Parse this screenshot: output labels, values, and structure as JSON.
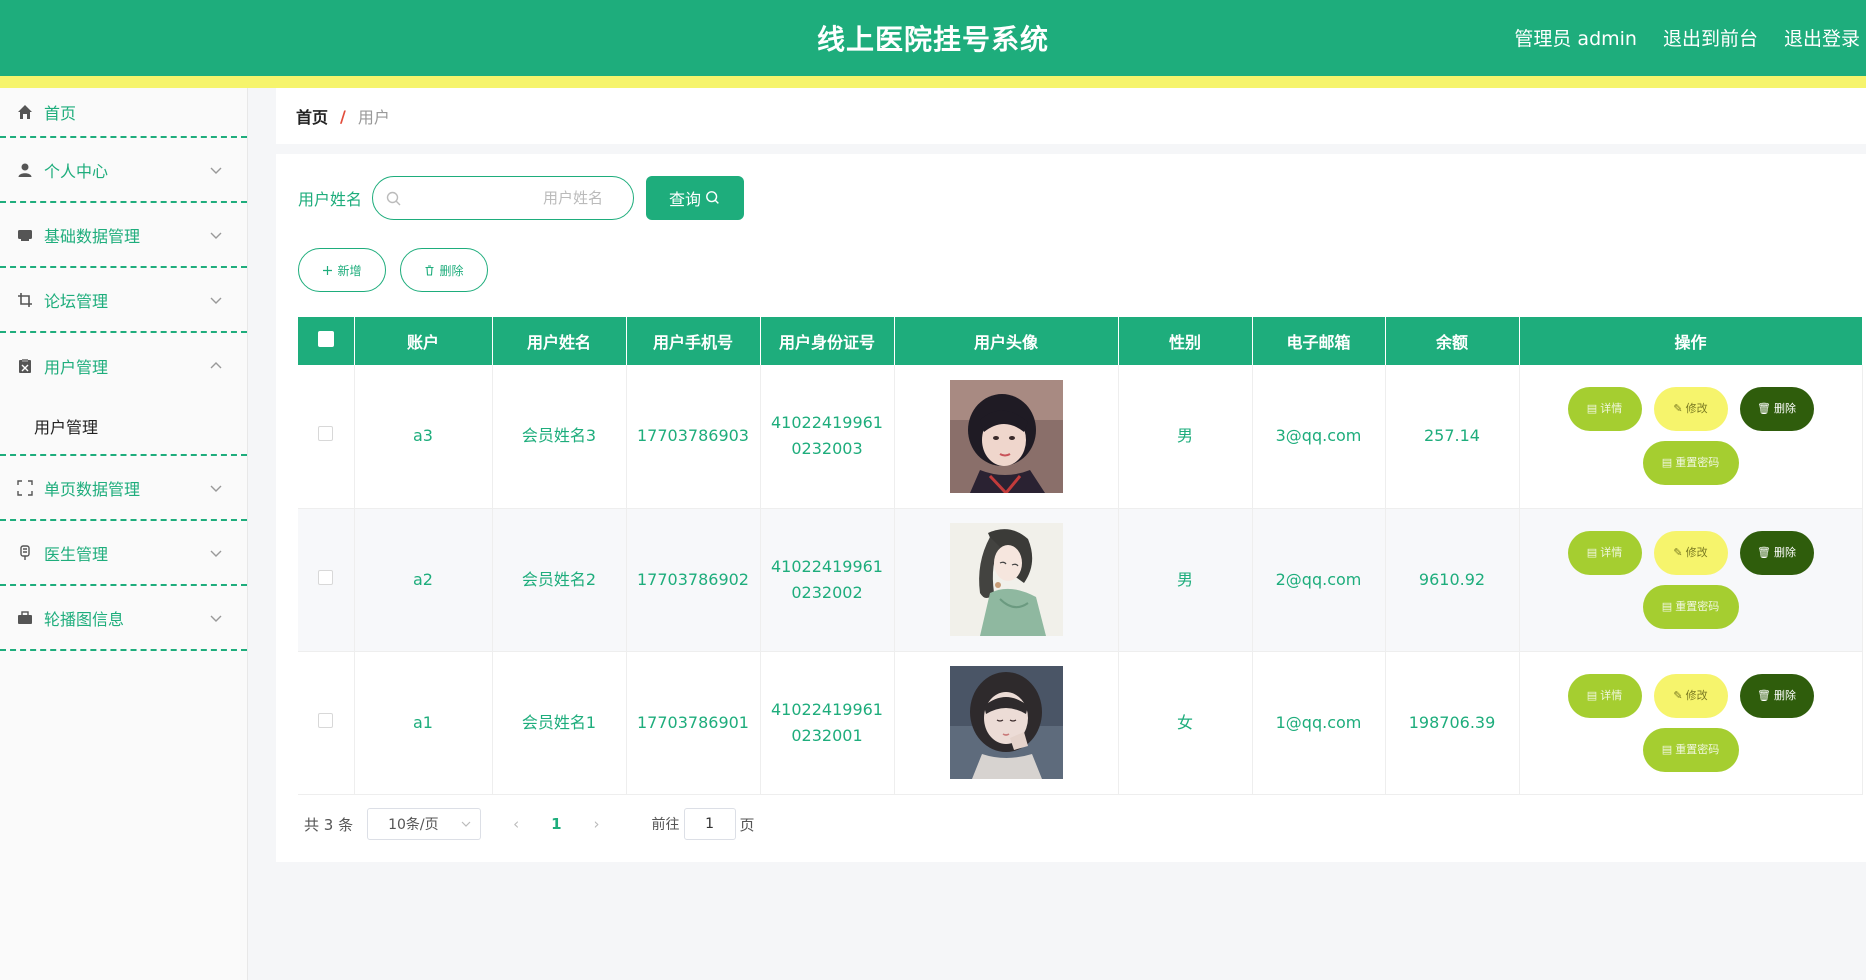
{
  "header": {
    "title": "线上医院挂号系统",
    "admin_label": "管理员 admin",
    "front_link": "退出到前台",
    "logout_link": "退出登录"
  },
  "sidebar": {
    "items": [
      {
        "label": "首页",
        "icon": "home-icon"
      },
      {
        "label": "个人中心",
        "icon": "user-icon"
      },
      {
        "label": "基础数据管理",
        "icon": "data-icon"
      },
      {
        "label": "论坛管理",
        "icon": "crop-icon"
      },
      {
        "label": "用户管理",
        "icon": "clipboard-icon",
        "sub": "用户管理"
      },
      {
        "label": "单页数据管理",
        "icon": "fullscreen-icon"
      },
      {
        "label": "医生管理",
        "icon": "doctor-icon"
      },
      {
        "label": "轮播图信息",
        "icon": "briefcase-icon"
      }
    ]
  },
  "breadcrumb": {
    "home": "首页",
    "separator": "/",
    "current": "用户"
  },
  "search": {
    "label": "用户姓名",
    "placeholder": "用户姓名",
    "value": "",
    "button": "查询"
  },
  "actions": {
    "add": "新增",
    "delete": "删除"
  },
  "table": {
    "headers": [
      "账户",
      "用户姓名",
      "用户手机号",
      "用户身份证号",
      "用户头像",
      "性别",
      "电子邮箱",
      "余额",
      "操作"
    ],
    "rows": [
      {
        "account": "a3",
        "name": "会员姓名3",
        "phone": "17703786903",
        "id_line1": "41022419961",
        "id_line2": "0232003",
        "gender": "男",
        "email": "3@qq.com",
        "balance": "257.14"
      },
      {
        "account": "a2",
        "name": "会员姓名2",
        "phone": "17703786902",
        "id_line1": "41022419961",
        "id_line2": "0232002",
        "gender": "男",
        "email": "2@qq.com",
        "balance": "9610.92"
      },
      {
        "account": "a1",
        "name": "会员姓名1",
        "phone": "17703786901",
        "id_line1": "41022419961",
        "id_line2": "0232001",
        "gender": "女",
        "email": "1@qq.com",
        "balance": "198706.39"
      }
    ],
    "ops": {
      "detail": "详情",
      "edit": "修改",
      "delete": "删除",
      "reset": "重置密码"
    }
  },
  "pagination": {
    "total": "共 3 条",
    "page_size": "10条/页",
    "current_page": "1",
    "goto_label": "前往",
    "goto_value": "1",
    "page_unit": "页"
  },
  "colors": {
    "primary": "#1ead7c",
    "accent_yellow": "#f6f46c",
    "detail": "#a5ce30",
    "delete": "#2f5d0c"
  }
}
